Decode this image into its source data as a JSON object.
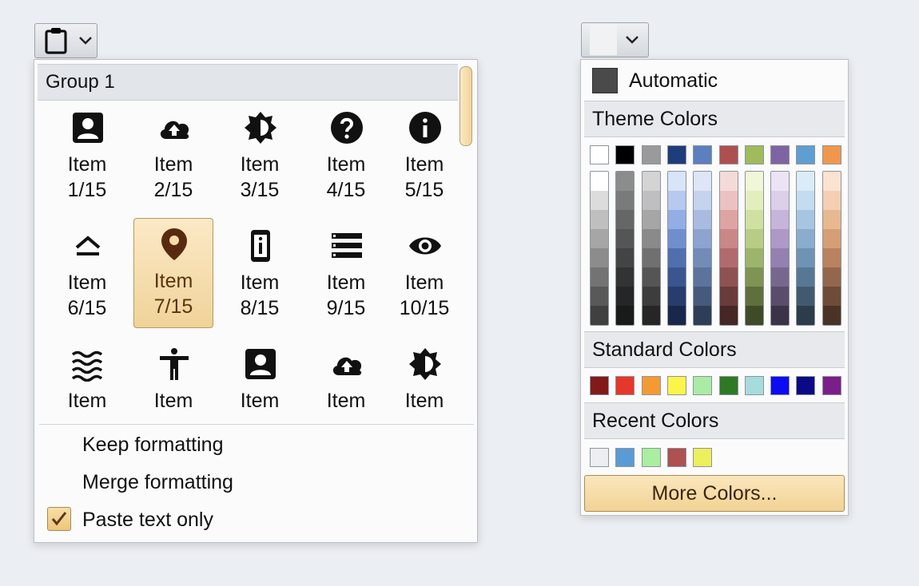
{
  "paste_button": {
    "icon": "clipboard-icon",
    "chevron": "chevron-down-icon"
  },
  "color_button": {
    "current_color": "#f1f2f4",
    "chevron": "chevron-down-icon"
  },
  "gallery": {
    "group_title": "Group 1",
    "items": [
      {
        "label": "Item\n1/15",
        "icon": "contact-card-icon"
      },
      {
        "label": "Item\n2/15",
        "icon": "cloud-upload-icon"
      },
      {
        "label": "Item\n3/15",
        "icon": "brightness-icon"
      },
      {
        "label": "Item\n4/15",
        "icon": "help-circle-icon"
      },
      {
        "label": "Item\n5/15",
        "icon": "info-circle-icon"
      },
      {
        "label": "Item\n6/15",
        "icon": "eject-icon"
      },
      {
        "label": "Item\n7/15",
        "icon": "location-pin-icon",
        "selected": true
      },
      {
        "label": "Item\n8/15",
        "icon": "device-info-icon"
      },
      {
        "label": "Item\n9/15",
        "icon": "list-icon"
      },
      {
        "label": "Item\n10/15",
        "icon": "eye-icon"
      },
      {
        "label": "Item",
        "icon": "waves-icon"
      },
      {
        "label": "Item",
        "icon": "accessibility-icon"
      },
      {
        "label": "Item",
        "icon": "contact-card-icon"
      },
      {
        "label": "Item",
        "icon": "cloud-upload-icon"
      },
      {
        "label": "Item",
        "icon": "brightness-icon"
      }
    ]
  },
  "paste_menu": {
    "keep_formatting": "Keep formatting",
    "merge_formatting": "Merge formatting",
    "paste_text_only": "Paste text only",
    "paste_text_only_checked": true
  },
  "color_panel": {
    "automatic_label": "Automatic",
    "automatic_color": "#4a4a4a",
    "theme_title": "Theme Colors",
    "theme_top": [
      "#ffffff",
      "#000000",
      "#9a9a9a",
      "#1f3d7a",
      "#5b7fbf",
      "#ae5050",
      "#9fbb5a",
      "#7f64a3",
      "#5f9ed1",
      "#f0974e"
    ],
    "theme_columns": [
      [
        "#ffffff",
        "#dcdcdc",
        "#bfbfbf",
        "#a6a6a6",
        "#8c8c8c",
        "#737373",
        "#595959",
        "#404040"
      ],
      [
        "#8c8c8c",
        "#7a7a7a",
        "#666666",
        "#555555",
        "#444444",
        "#333333",
        "#262626",
        "#1a1a1a"
      ],
      [
        "#d4d4d4",
        "#bfbfbf",
        "#a6a6a6",
        "#8a8a8a",
        "#707070",
        "#555555",
        "#3d3d3d",
        "#262626"
      ],
      [
        "#d8e4f8",
        "#b6c9ee",
        "#93aee4",
        "#6f8fcc",
        "#4f6fae",
        "#3a5590",
        "#273d6e",
        "#17284c"
      ],
      [
        "#dde6f6",
        "#c6d3ee",
        "#a9bbe0",
        "#8ea3cf",
        "#748bb8",
        "#5c739c",
        "#455a7c",
        "#2f3e58"
      ],
      [
        "#f5dada",
        "#ecc1c1",
        "#dea3a3",
        "#c98787",
        "#b06c6c",
        "#8e5252",
        "#6a3b3b",
        "#472626"
      ],
      [
        "#eff7d8",
        "#e2efbd",
        "#cfe0a0",
        "#b8cc85",
        "#9db46b",
        "#7f9453",
        "#5f703d",
        "#3f4b28"
      ],
      [
        "#ece4f5",
        "#dccfea",
        "#c6b4db",
        "#ad98c8",
        "#9480b1",
        "#77678f",
        "#594d6b",
        "#3b3348"
      ],
      [
        "#dbecf8",
        "#c3dcf0",
        "#a6c5e2",
        "#8aadcf",
        "#6f93b5",
        "#577895",
        "#425a70",
        "#2c3c4b"
      ],
      [
        "#fbe3d2",
        "#f5cfb1",
        "#e8b891",
        "#d59e76",
        "#b98260",
        "#94674c",
        "#6f4c38",
        "#4a3326"
      ]
    ],
    "standard_title": "Standard Colors",
    "standard_colors": [
      "#821a1a",
      "#e6372b",
      "#f39b33",
      "#fbf54a",
      "#aaeca5",
      "#2e7a24",
      "#a7dcdc",
      "#0c0cf2",
      "#0a0a86",
      "#7a1e8a"
    ],
    "recent_title": "Recent Colors",
    "recent_colors": [
      "#eceef1",
      "#5b9bd5",
      "#a9ef9f",
      "#ad5151",
      "#eeef5c"
    ],
    "more_colors_label": "More Colors..."
  }
}
